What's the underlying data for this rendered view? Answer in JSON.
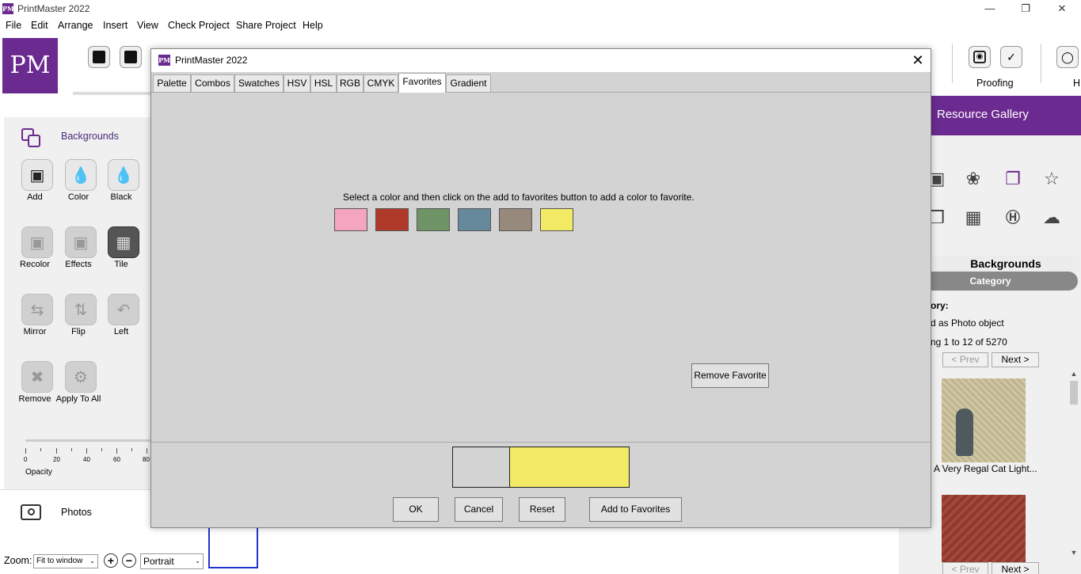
{
  "app": {
    "window_title": "PrintMaster 2022",
    "logo_text": "PM",
    "icon_text": "PM"
  },
  "menu": [
    "File",
    "Edit",
    "Arrange",
    "Insert",
    "View",
    "Check Project",
    "Share Project",
    "Help"
  ],
  "toolbar": {
    "proofing_label": "Proofing",
    "cut_label": "H"
  },
  "left_panel": {
    "section_title": "Backgrounds",
    "tools": [
      {
        "label": "Add"
      },
      {
        "label": "Color"
      },
      {
        "label": "Black"
      },
      {
        "label": "Recolor"
      },
      {
        "label": "Effects"
      },
      {
        "label": "Tile"
      },
      {
        "label": "Mirror"
      },
      {
        "label": "Flip"
      },
      {
        "label": "Left"
      },
      {
        "label": "Remove"
      },
      {
        "label": "Apply To All"
      }
    ],
    "opacity_ticks": [
      "0",
      "20",
      "40",
      "60",
      "80"
    ],
    "opacity_label": "Opacity",
    "photos_label": "Photos"
  },
  "zoom_bar": {
    "zoom_label": "Zoom:",
    "zoom_value": "Fit to window",
    "orientation_value": "Portrait"
  },
  "resource_gallery": {
    "title": "Resource Gallery",
    "category_title": "Backgrounds",
    "category_button": "Category",
    "category_label": "ory:",
    "as_photo_text": "d as Photo object",
    "count_text": "ng 1 to 12 of 5270",
    "prev_label": "< Prev",
    "next_label": "Next >",
    "item_caption": "A Very Regal Cat Light..."
  },
  "dialog": {
    "title": "PrintMaster 2022",
    "close_symbol": "✕",
    "tabs": [
      "Palette",
      "Combos",
      "Swatches",
      "HSV",
      "HSL",
      "RGB",
      "CMYK",
      "Favorites",
      "Gradient"
    ],
    "active_tab": "Favorites",
    "instructions": "Select a color and then click on the add to favorites button to add a color to favorite.",
    "favorites": [
      "#f4a5c0",
      "#b03a2a",
      "#6e9466",
      "#66899c",
      "#978a7c",
      "#f2e964"
    ],
    "remove_favorite_label": "Remove Favorite",
    "previous_color": "#d3d3d3",
    "new_color": "#f2e964",
    "ok_label": "OK",
    "cancel_label": "Cancel",
    "reset_label": "Reset",
    "add_favorites_label": "Add to Favorites"
  },
  "colors": {
    "brand_purple": "#6b2a8f"
  }
}
